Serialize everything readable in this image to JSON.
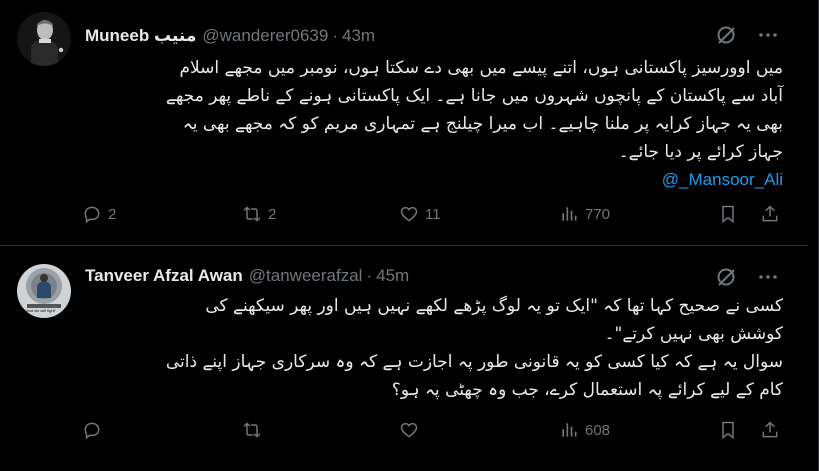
{
  "tweets": [
    {
      "display_name": "Muneeb منیب",
      "handle": "@wanderer0639",
      "time": "43m",
      "text_lines": [
        "میں اوورسیز پاکستانی ہوں، اتنے پیسے میں بھی دے سکتا ہوں، نومبر میں مجھے اسلام",
        "آباد سے پاکستان کے پانچوں شہروں میں جانا ہے۔ ایک پاکستانی ہونے کے ناطے پھر مجھے",
        "بھی یہ جہاز کرایہ پر ملنا چاہیے۔ اب میرا چیلنج ہے تمہاری مریم کو کہ مجھے بھی یہ",
        "جہاز کرائے پر دیا جائے۔"
      ],
      "mention": "@_Mansoor_Ali",
      "replies": "2",
      "reposts": "2",
      "likes": "11",
      "views": "770"
    },
    {
      "display_name": "Tanveer Afzal Awan",
      "handle": "@tanweerafzal",
      "time": "45m",
      "text_lines": [
        "کسی نے صحیح کہا تھا کہ \"ایک تو یہ لوگ پڑھے لکھے نہیں ہیں اور پھر سیکھنے کی",
        "کوشش بھی نہیں کرتے\"۔",
        "سوال یہ ہے کہ کیا کسی کو یہ قانونی طور پہ اجازت ہے کہ وہ سرکاری جہاز اپنے ذاتی",
        "کام کے لیے کرائے پہ استعمال کرے، جب وہ چھٹی پہ ہو؟"
      ],
      "replies": "",
      "reposts": "",
      "likes": "",
      "views": "608",
      "avatar_caption": "\"and we will fight\""
    }
  ],
  "icons": {
    "grok": "grok-icon",
    "more": "more-icon",
    "reply": "reply-icon",
    "repost": "repost-icon",
    "like": "like-icon",
    "views": "views-icon",
    "bookmark": "bookmark-icon",
    "share": "share-icon"
  },
  "colors": {
    "background": "#000000",
    "text": "#e7e9ea",
    "muted": "#71767b",
    "link": "#1d9bf0",
    "border": "#2f3336"
  }
}
